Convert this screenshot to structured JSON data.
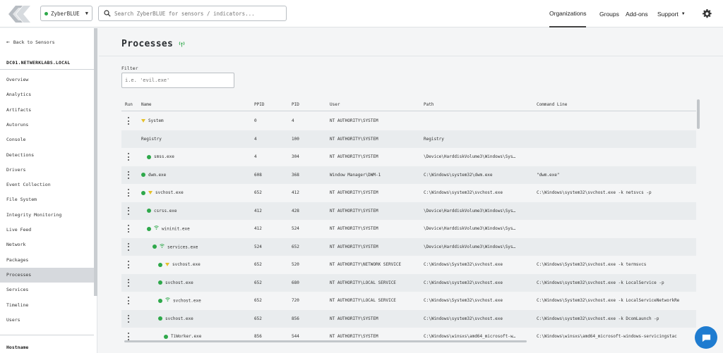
{
  "org_selector": {
    "label": "ZyberBLUE",
    "status_color": "#2ea84a"
  },
  "search": {
    "placeholder": "Search ZyberBLUE for sensors / indicators..."
  },
  "nav": {
    "organizations": "Organizations",
    "groups": "Groups",
    "addons": "Add-ons",
    "support": "Support"
  },
  "sidebar": {
    "back_label": "Back to Sensors",
    "hostname": "DC01.NETWERKLABS.LOCAL",
    "items": [
      {
        "label": "Overview"
      },
      {
        "label": "Analytics"
      },
      {
        "label": "Artifacts"
      },
      {
        "label": "Autoruns"
      },
      {
        "label": "Console"
      },
      {
        "label": "Detections"
      },
      {
        "label": "Drivers"
      },
      {
        "label": "Event Collection"
      },
      {
        "label": "File System"
      },
      {
        "label": "Integrity Monitoring"
      },
      {
        "label": "Live Feed"
      },
      {
        "label": "Network"
      },
      {
        "label": "Packages"
      },
      {
        "label": "Processes",
        "active": true
      },
      {
        "label": "Services"
      },
      {
        "label": "Timeline"
      },
      {
        "label": "Users"
      }
    ],
    "bottom_label": "Hostname"
  },
  "page": {
    "title": "Processes",
    "filter_label": "Filter",
    "filter_placeholder": "i.e. 'evil.exe'"
  },
  "table": {
    "columns": [
      "Run",
      "Name",
      "PPID",
      "PID",
      "User",
      "Path",
      "Command Line"
    ],
    "rows": [
      {
        "name": "System",
        "ppid": "0",
        "pid": "4",
        "user": "NT AUTHORITY\\SYSTEM",
        "path": "",
        "cmd": "",
        "indent": 0,
        "icons": [
          "warning"
        ],
        "kebab": true
      },
      {
        "name": "Registry",
        "ppid": "4",
        "pid": "100",
        "user": "NT AUTHORITY\\SYSTEM",
        "path": "Registry",
        "cmd": "",
        "indent": 0,
        "icons": [],
        "kebab": false
      },
      {
        "name": "smss.exe",
        "ppid": "4",
        "pid": "304",
        "user": "NT AUTHORITY\\SYSTEM",
        "path": "\\Device\\HarddiskVolume3\\Windows\\Sys…",
        "cmd": "",
        "indent": 1,
        "icons": [
          "ok"
        ],
        "kebab": true
      },
      {
        "name": "dwm.exe",
        "ppid": "608",
        "pid": "368",
        "user": "Window Manager\\DWM-1",
        "path": "C:\\Windows\\system32\\dwm.exe",
        "cmd": "\"dwm.exe\"",
        "indent": 0,
        "icons": [
          "ok"
        ],
        "kebab": true
      },
      {
        "name": "svchost.exe",
        "ppid": "652",
        "pid": "412",
        "user": "NT AUTHORITY\\SYSTEM",
        "path": "C:\\Windows\\system32\\svchost.exe",
        "cmd": "C:\\Windows\\system32\\svchost.exe -k netsvcs -p",
        "indent": 0,
        "icons": [
          "ok",
          "warning"
        ],
        "kebab": true
      },
      {
        "name": "csrss.exe",
        "ppid": "412",
        "pid": "428",
        "user": "NT AUTHORITY\\SYSTEM",
        "path": "\\Device\\HarddiskVolume3\\Windows\\Sys…",
        "cmd": "",
        "indent": 1,
        "icons": [
          "ok"
        ],
        "kebab": true
      },
      {
        "name": "wininit.exe",
        "ppid": "412",
        "pid": "524",
        "user": "NT AUTHORITY\\SYSTEM",
        "path": "\\Device\\HarddiskVolume3\\Windows\\Sys…",
        "cmd": "",
        "indent": 1,
        "icons": [
          "ok",
          "network"
        ],
        "kebab": true
      },
      {
        "name": "services.exe",
        "ppid": "524",
        "pid": "652",
        "user": "NT AUTHORITY\\SYSTEM",
        "path": "\\Device\\HarddiskVolume3\\Windows\\Sys…",
        "cmd": "",
        "indent": 2,
        "icons": [
          "ok",
          "network"
        ],
        "kebab": true
      },
      {
        "name": "svchost.exe",
        "ppid": "652",
        "pid": "520",
        "user": "NT AUTHORITY\\NETWORK SERVICE",
        "path": "C:\\Windows\\System32\\svchost.exe",
        "cmd": "C:\\Windows\\System32\\svchost.exe -k termsvcs",
        "indent": 3,
        "icons": [
          "ok",
          "warning"
        ],
        "kebab": true
      },
      {
        "name": "svchost.exe",
        "ppid": "652",
        "pid": "680",
        "user": "NT AUTHORITY\\LOCAL SERVICE",
        "path": "C:\\Windows\\system32\\svchost.exe",
        "cmd": "C:\\Windows\\system32\\svchost.exe -k LocalService -p",
        "indent": 3,
        "icons": [
          "ok"
        ],
        "kebab": true
      },
      {
        "name": "svchost.exe",
        "ppid": "652",
        "pid": "720",
        "user": "NT AUTHORITY\\LOCAL SERVICE",
        "path": "C:\\Windows\\System32\\svchost.exe",
        "cmd": "C:\\Windows\\System32\\svchost.exe -k LocalServiceNetworkRe",
        "indent": 3,
        "icons": [
          "ok",
          "network"
        ],
        "kebab": true
      },
      {
        "name": "svchost.exe",
        "ppid": "652",
        "pid": "856",
        "user": "NT AUTHORITY\\SYSTEM",
        "path": "C:\\Windows\\system32\\svchost.exe",
        "cmd": "C:\\Windows\\system32\\svchost.exe -k DcomLaunch -p",
        "indent": 3,
        "icons": [
          "ok"
        ],
        "kebab": true
      },
      {
        "name": "TiWorker.exe",
        "ppid": "856",
        "pid": "544",
        "user": "NT AUTHORITY\\SYSTEM",
        "path": "C:\\Windows\\winsxs\\amd64_microsoft-w…",
        "cmd": "C:\\Windows\\winsxs\\amd64_microsoft-windows-servicingstac",
        "indent": 4,
        "icons": [
          "ok"
        ],
        "kebab": true
      }
    ]
  },
  "colors": {
    "ok": "#2ea84a",
    "warning": "#e6c12a",
    "network": "#2ea84a",
    "accent": "#1f7cd0"
  }
}
